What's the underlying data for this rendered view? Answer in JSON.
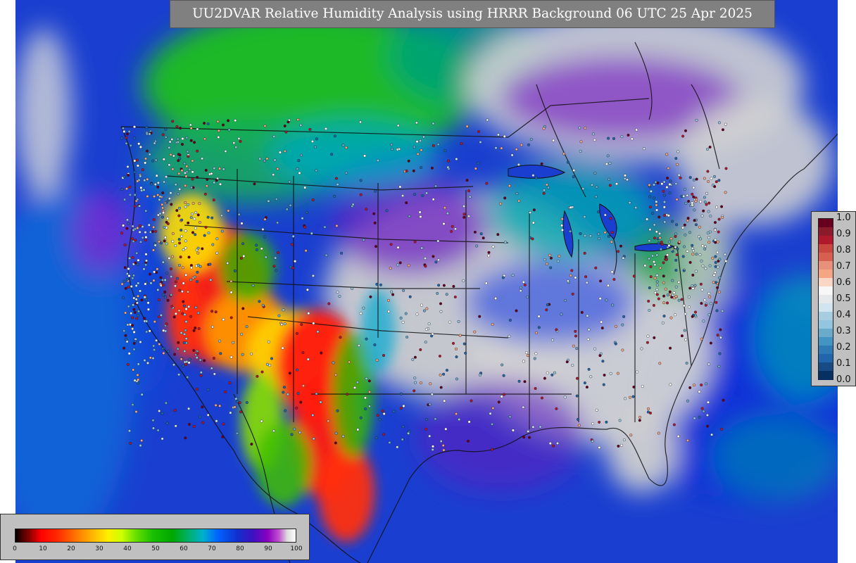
{
  "title": "UU2DVAR Relative Humidity Analysis using HRRR Background 06 UTC 25 Apr 2025",
  "map": {
    "region": "CONUS",
    "colors": {
      "ocean_wet": "#1a3fd0",
      "dry_red": "#e81010",
      "dry_orange": "#ff8a00",
      "yellow": "#ffe400",
      "green": "#20c020",
      "cyan": "#00b8c8",
      "purple": "#7a10c0",
      "saturated_gray": "#d2d2d2",
      "borders": "#111111"
    }
  },
  "obs_colorbar": {
    "ticks": [
      "1.0",
      "0.9",
      "0.8",
      "0.7",
      "0.6",
      "0.5",
      "0.4",
      "0.3",
      "0.2",
      "0.1",
      "0.0"
    ],
    "colors": [
      "#67001f",
      "#8b1a2b",
      "#b2182b",
      "#c9473f",
      "#d6604d",
      "#e8917a",
      "#f4a582",
      "#fad6c4",
      "#f7f7f7",
      "#e6e9ec",
      "#d1e5f0",
      "#a9cde0",
      "#92c5de",
      "#6aaacb",
      "#4393c3",
      "#2f79b5",
      "#2166ac",
      "#164b86",
      "#053061"
    ]
  },
  "rh_colorbar": {
    "ticks": [
      "0",
      "10",
      "20",
      "30",
      "40",
      "50",
      "60",
      "70",
      "80",
      "90",
      "100"
    ]
  }
}
